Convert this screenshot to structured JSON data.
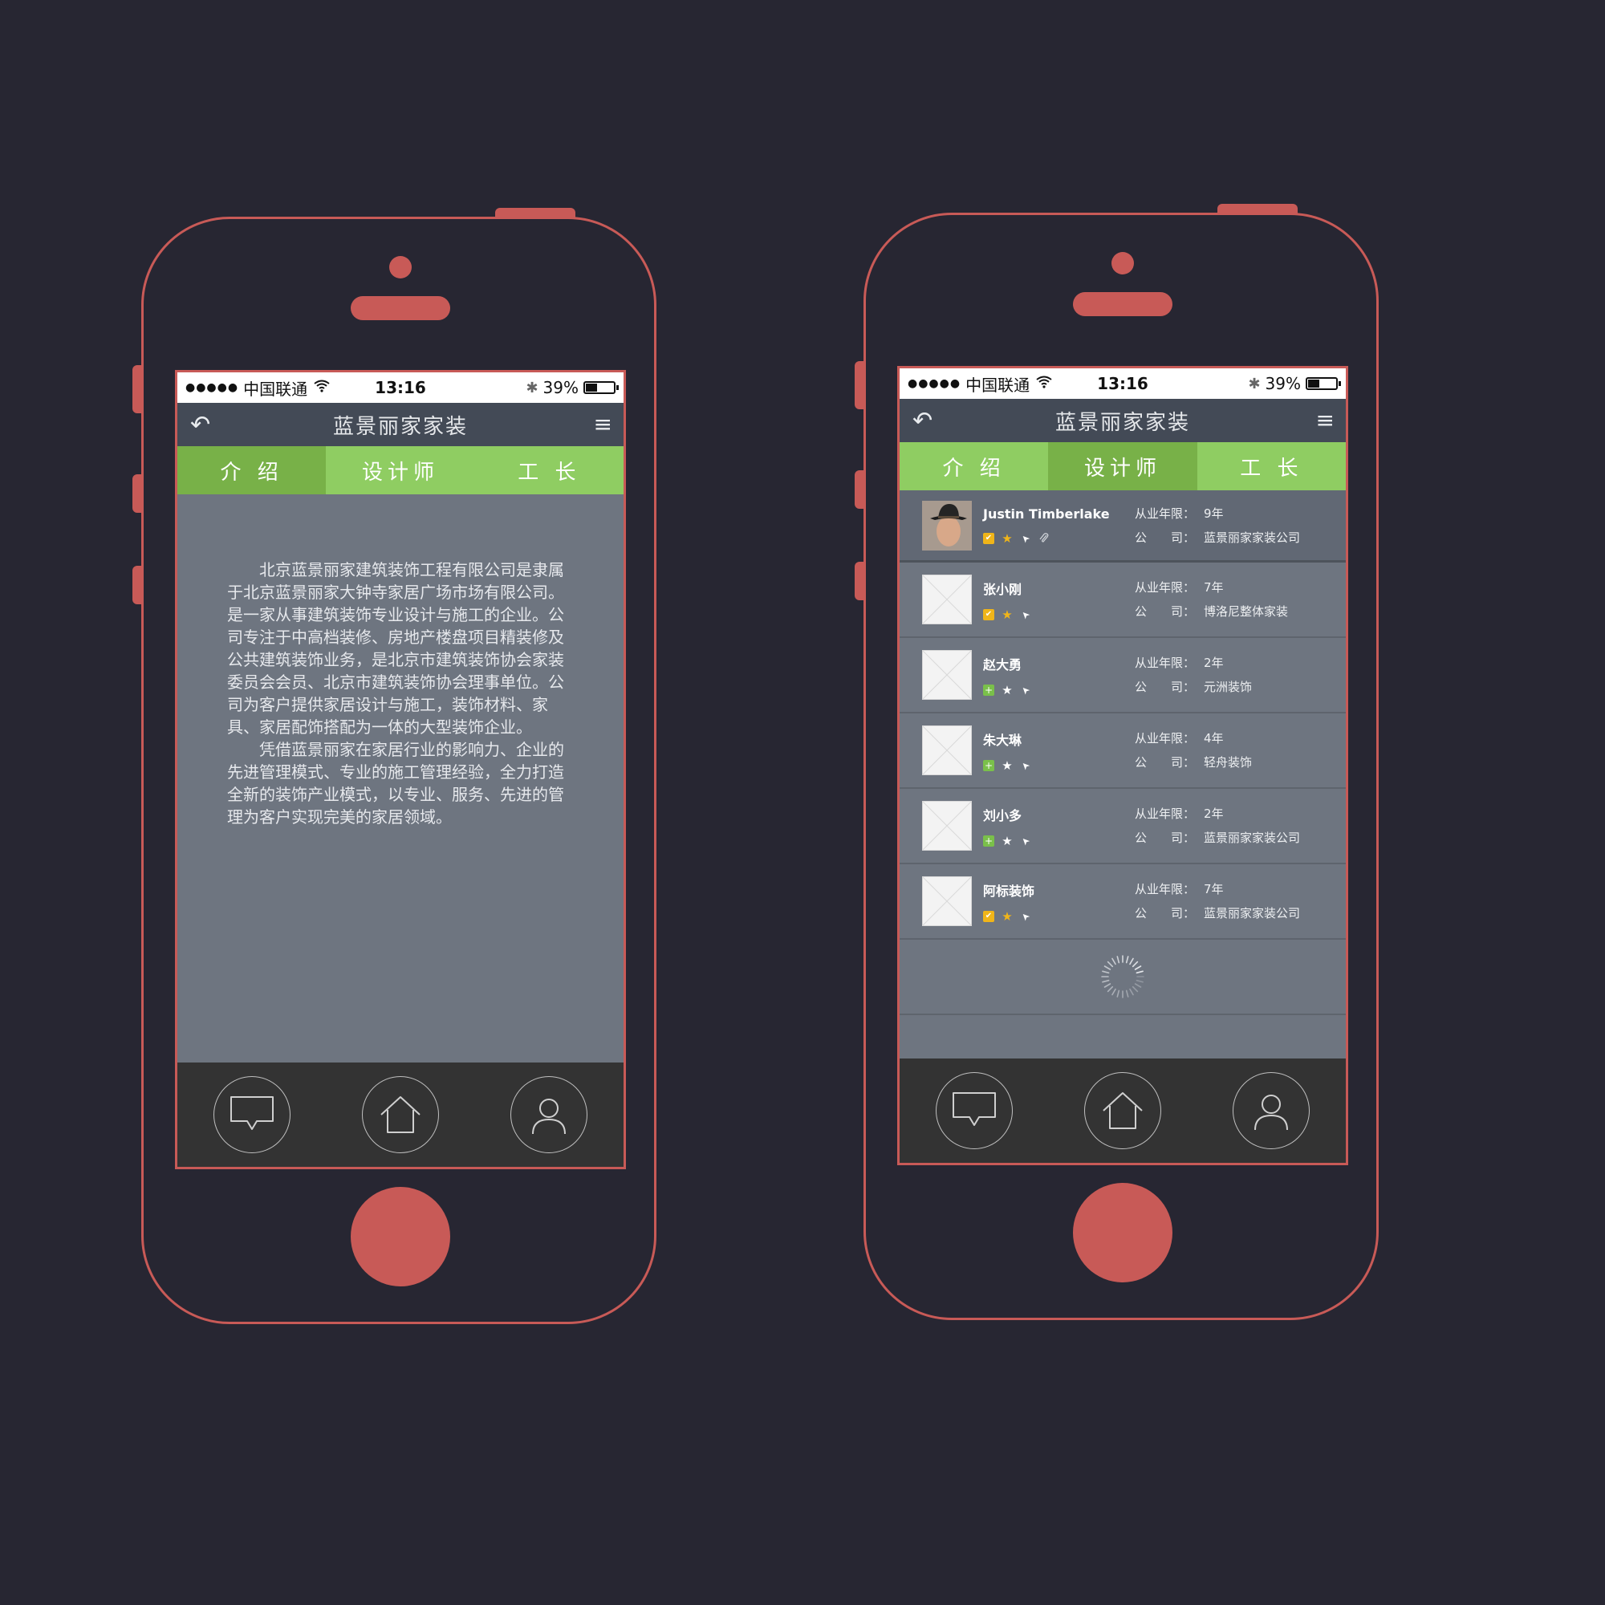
{
  "status": {
    "signal": "●●●●●",
    "carrier": "中国联通",
    "time": "13:16",
    "battery": "39%",
    "battery_level": 0.39
  },
  "header": {
    "title": "蓝景丽家家装",
    "back_icon": "back-arrow-icon",
    "menu_icon": "hamburger-menu-icon"
  },
  "tabs": [
    "介 绍",
    "设计师",
    "工 长"
  ],
  "intro": {
    "paragraphs": [
      "北京蓝景丽家建筑装饰工程有限公司是隶属于北京蓝景丽家大钟寺家居广场市场有限公司。是一家从事建筑装饰专业设计与施工的企业。公司专注于中高档装修、房地产楼盘项目精装修及公共建筑装饰业务，是北京市建筑装饰协会家装委员会会员、北京市建筑装饰协会理事单位。公司为客户提供家居设计与施工，装饰材料、家具、家居配饰搭配为一体的大型装饰企业。",
      "凭借蓝景丽家在家居行业的影响力、企业的先进管理模式、专业的施工管理经验，全力打造全新的装饰产业模式，以专业、服务、先进的管理为客户实现完美的家居领域。"
    ]
  },
  "designers": {
    "label_years": "从业年限：",
    "label_company": "公　　司：",
    "items": [
      {
        "name": "Justin Timberlake",
        "years": "9年",
        "company": "蓝景丽家家装公司",
        "badge": "check",
        "star": "gold",
        "clip": true
      },
      {
        "name": "张小刚",
        "years": "7年",
        "company": "博洛尼整体家装",
        "badge": "check",
        "star": "gold",
        "clip": false
      },
      {
        "name": "赵大勇",
        "years": "2年",
        "company": "元洲装饰",
        "badge": "plus",
        "star": "white",
        "clip": false
      },
      {
        "name": "朱大琳",
        "years": "4年",
        "company": "轻舟装饰",
        "badge": "plus",
        "star": "white",
        "clip": false
      },
      {
        "name": "刘小多",
        "years": "2年",
        "company": "蓝景丽家家装公司",
        "badge": "plus",
        "star": "white",
        "clip": false
      },
      {
        "name": "阿标装饰",
        "years": "7年",
        "company": "蓝景丽家家装公司",
        "badge": "check",
        "star": "gold",
        "clip": false
      }
    ]
  },
  "tabbar": [
    "message-bubble-icon",
    "home-icon",
    "user-profile-icon"
  ],
  "colors": {
    "background": "#272632",
    "phone_outline": "#c85a57",
    "tab_green": "#8fcd62",
    "tab_green_active": "#78b148",
    "nav_bar": "#434a56",
    "content_gray": "#6e7580",
    "tabbar_dark": "#333333"
  }
}
